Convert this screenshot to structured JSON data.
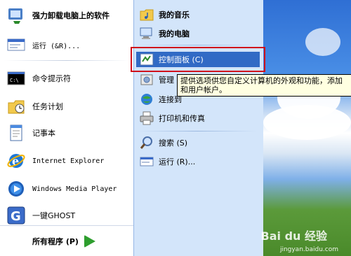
{
  "left_menu": {
    "items": [
      {
        "label": "强力卸载电脑上的软件",
        "icon": "uninstall-icon"
      },
      {
        "label": "运行 (&R)...",
        "icon": "run-icon"
      },
      {
        "label": "命令提示符",
        "icon": "cmd-icon"
      },
      {
        "label": "任务计划",
        "icon": "scheduled-tasks-icon"
      },
      {
        "label": "记事本",
        "icon": "notepad-icon"
      },
      {
        "label": "Internet Explorer",
        "icon": "ie-icon"
      },
      {
        "label": "Windows Media Player",
        "icon": "media-player-icon"
      },
      {
        "label": "一键GHOST",
        "icon": "ghost-icon"
      }
    ],
    "all_programs": "所有程序 (P)"
  },
  "right_menu": {
    "items": [
      {
        "label": "我的音乐",
        "icon": "music-folder-icon"
      },
      {
        "label": "我的电脑",
        "icon": "computer-icon"
      },
      {
        "label": "控制面板 (C)",
        "icon": "control-panel-icon"
      },
      {
        "label": "管理",
        "icon": "admin-tools-icon"
      },
      {
        "label": "连接到",
        "icon": "connect-icon"
      },
      {
        "label": "打印机和传真",
        "icon": "printer-icon"
      },
      {
        "label": "搜索 (S)",
        "icon": "search-icon"
      },
      {
        "label": "运行 (R)...",
        "icon": "run-icon"
      }
    ]
  },
  "tooltip": {
    "line1": "提供选项供您自定义计算机的外观和功能，添加",
    "line2": "和用户帐户。"
  },
  "watermark": {
    "brand": "Bai du 经验",
    "url": "jingyan.baidu.com"
  },
  "colors": {
    "highlight": "#316ac5",
    "right_pane": "#d3e5fa",
    "annotation_box": "#d0111b"
  }
}
